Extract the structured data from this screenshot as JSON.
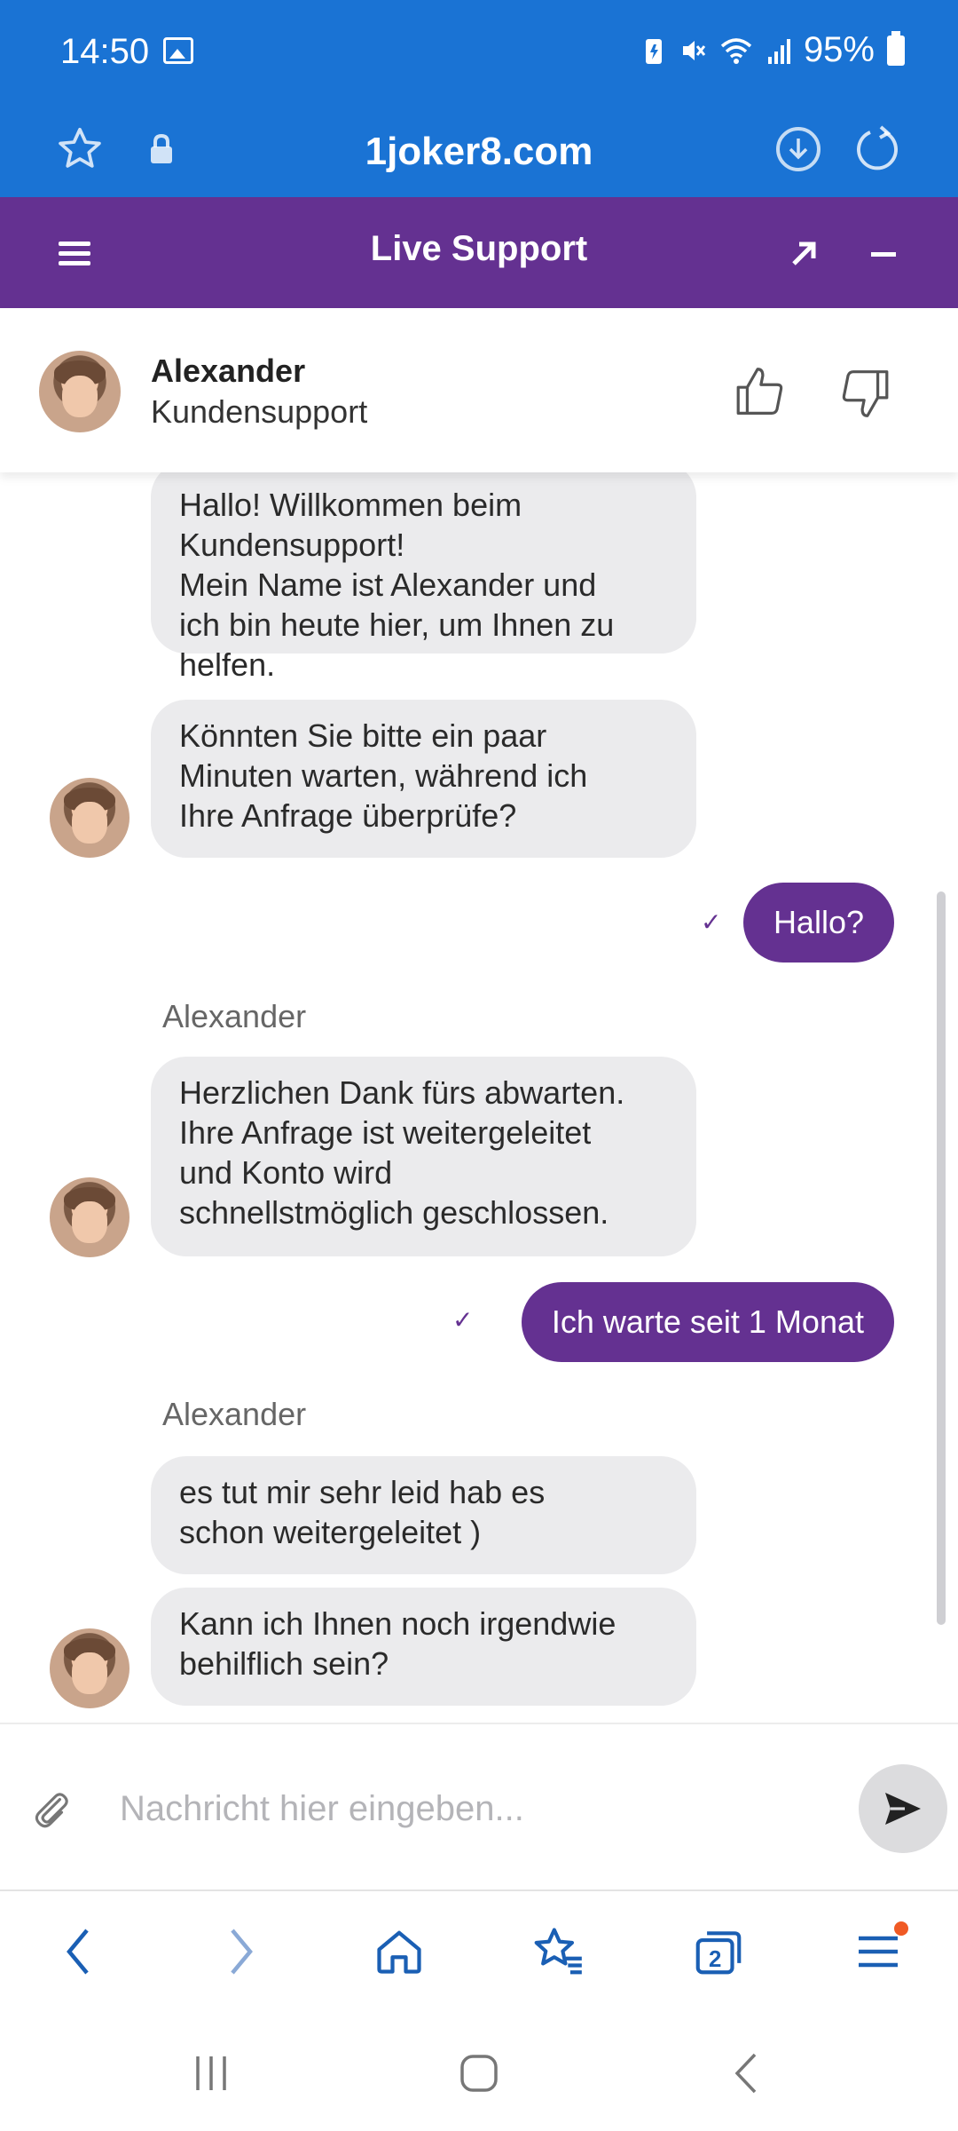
{
  "status_bar": {
    "time": "14:50",
    "battery": "95%"
  },
  "browser": {
    "url": "1joker8.com",
    "tab_count": "2"
  },
  "chat_header": {
    "title": "Live Support"
  },
  "agent": {
    "name": "Alexander",
    "role": "Kundensupport"
  },
  "messages": {
    "m1": "Hallo! Willkommen beim\nKundensupport!\nMein Name ist Alexander und\nich bin heute hier, um Ihnen zu\nhelfen.",
    "m2": "Könnten Sie bitte ein paar\nMinuten warten, während ich\nIhre Anfrage überprüfe?",
    "u1": "Hallo?",
    "sender1": "Alexander",
    "m3": "Herzlichen Dank fürs abwarten.\nIhre Anfrage ist weitergeleitet\nund Konto wird\nschnellstmöglich geschlossen.",
    "u2": "Ich warte seit 1 Monat",
    "sender2": "Alexander",
    "m4": "es tut mir sehr leid hab es\nschon weitergeleitet )",
    "m5": "Kann ich Ihnen noch irgendwie\nbehilflich sein?"
  },
  "composer": {
    "placeholder": "Nachricht hier eingeben..."
  },
  "colors": {
    "browser_blue": "#1a73d4",
    "brand_purple": "#643191",
    "bubble_gray": "#ebebed"
  }
}
